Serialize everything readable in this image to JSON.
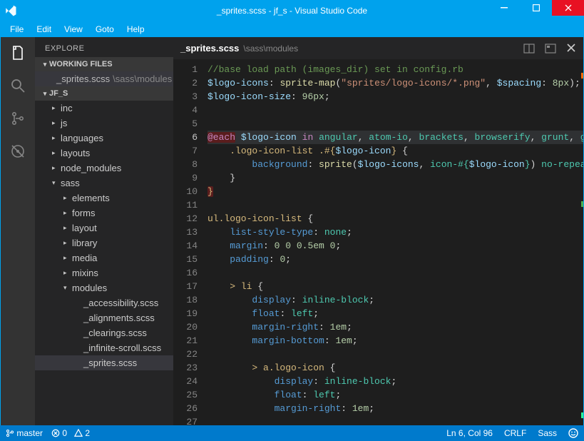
{
  "window": {
    "title": "_sprites.scss - jf_s - Visual Studio Code"
  },
  "menu": {
    "file": "File",
    "edit": "Edit",
    "view": "View",
    "goto": "Goto",
    "help": "Help"
  },
  "sidebar": {
    "header": "EXPLORE",
    "working_files_label": "WORKING FILES",
    "working_file": {
      "name": "_sprites.scss",
      "path": "\\sass\\modules"
    },
    "project_label": "JF_S",
    "tree": [
      {
        "label": "inc",
        "kind": "folder",
        "open": false,
        "depth": 1
      },
      {
        "label": "js",
        "kind": "folder",
        "open": false,
        "depth": 1
      },
      {
        "label": "languages",
        "kind": "folder",
        "open": false,
        "depth": 1
      },
      {
        "label": "layouts",
        "kind": "folder",
        "open": false,
        "depth": 1
      },
      {
        "label": "node_modules",
        "kind": "folder",
        "open": false,
        "depth": 1
      },
      {
        "label": "sass",
        "kind": "folder",
        "open": true,
        "depth": 1
      },
      {
        "label": "elements",
        "kind": "folder",
        "open": false,
        "depth": 2
      },
      {
        "label": "forms",
        "kind": "folder",
        "open": false,
        "depth": 2
      },
      {
        "label": "layout",
        "kind": "folder",
        "open": false,
        "depth": 2
      },
      {
        "label": "library",
        "kind": "folder",
        "open": false,
        "depth": 2
      },
      {
        "label": "media",
        "kind": "folder",
        "open": false,
        "depth": 2
      },
      {
        "label": "mixins",
        "kind": "folder",
        "open": false,
        "depth": 2
      },
      {
        "label": "modules",
        "kind": "folder",
        "open": true,
        "depth": 2
      },
      {
        "label": "_accessibility.scss",
        "kind": "file",
        "depth": 3
      },
      {
        "label": "_alignments.scss",
        "kind": "file",
        "depth": 3
      },
      {
        "label": "_clearings.scss",
        "kind": "file",
        "depth": 3
      },
      {
        "label": "_infinite-scroll.scss",
        "kind": "file",
        "depth": 3
      },
      {
        "label": "_sprites.scss",
        "kind": "file",
        "depth": 3,
        "selected": true
      }
    ]
  },
  "tab": {
    "name": "_sprites.scss",
    "path": "\\sass\\modules"
  },
  "status": {
    "branch": "master",
    "errors": "0",
    "warnings": "2",
    "cursor": "Ln 6, Col 96",
    "eol": "CRLF",
    "lang": "Sass"
  },
  "code": {
    "current_line": 6,
    "lines": [
      {
        "n": 1,
        "tokens": [
          [
            "c-comment",
            "//base load path (images_dir) set in config.rb"
          ]
        ]
      },
      {
        "n": 2,
        "tokens": [
          [
            "c-var",
            "$logo-icons"
          ],
          [
            "c-punc",
            ": "
          ],
          [
            "c-func",
            "sprite-map"
          ],
          [
            "c-punc",
            "("
          ],
          [
            "c-str",
            "\"sprites/logo-icons/*.png\""
          ],
          [
            "c-punc",
            ", "
          ],
          [
            "c-var",
            "$spacing"
          ],
          [
            "c-punc",
            ": "
          ],
          [
            "c-num",
            "8px"
          ],
          [
            "c-punc",
            ");"
          ]
        ]
      },
      {
        "n": 3,
        "tokens": [
          [
            "c-var",
            "$logo-icon-size"
          ],
          [
            "c-punc",
            ": "
          ],
          [
            "c-num",
            "96px"
          ],
          [
            "c-punc",
            ";"
          ]
        ]
      },
      {
        "n": 4,
        "tokens": []
      },
      {
        "n": 5,
        "tokens": []
      },
      {
        "n": 6,
        "current": true,
        "tokens": [
          [
            "c-key c-redbg",
            "@each"
          ],
          [
            "c-punc",
            " "
          ],
          [
            "c-var",
            "$logo-icon"
          ],
          [
            "c-punc",
            " "
          ],
          [
            "c-key",
            "in"
          ],
          [
            "c-punc",
            " "
          ],
          [
            "c-name",
            "angular"
          ],
          [
            "c-punc",
            ", "
          ],
          [
            "c-name",
            "atom-io"
          ],
          [
            "c-punc",
            ", "
          ],
          [
            "c-name",
            "brackets"
          ],
          [
            "c-punc",
            ", "
          ],
          [
            "c-name",
            "browserify"
          ],
          [
            "c-punc",
            ", "
          ],
          [
            "c-name",
            "grunt"
          ],
          [
            "c-punc",
            ", "
          ],
          [
            "c-name",
            "gu"
          ]
        ]
      },
      {
        "n": 7,
        "tokens": [
          [
            "c-punc",
            "    "
          ],
          [
            "c-sel",
            ".logo-icon-list .#{"
          ],
          [
            "c-var",
            "$logo-icon"
          ],
          [
            "c-sel",
            "}"
          ],
          [
            "c-punc",
            " {"
          ]
        ]
      },
      {
        "n": 8,
        "tokens": [
          [
            "c-punc",
            "        "
          ],
          [
            "c-blue",
            "background"
          ],
          [
            "c-punc",
            ": "
          ],
          [
            "c-func",
            "sprite"
          ],
          [
            "c-punc",
            "("
          ],
          [
            "c-var",
            "$logo-icons"
          ],
          [
            "c-punc",
            ", "
          ],
          [
            "c-name",
            "icon-#{"
          ],
          [
            "c-var",
            "$logo-icon"
          ],
          [
            "c-name",
            "}"
          ],
          [
            "c-punc",
            ") "
          ],
          [
            "c-name",
            "no-repeat"
          ]
        ]
      },
      {
        "n": 9,
        "tokens": [
          [
            "c-punc",
            "    }"
          ]
        ]
      },
      {
        "n": 10,
        "tokens": [
          [
            "c-sel c-redbg",
            "}"
          ]
        ]
      },
      {
        "n": 11,
        "tokens": []
      },
      {
        "n": 12,
        "tokens": [
          [
            "c-sel",
            "ul.logo-icon-list"
          ],
          [
            "c-punc",
            " {"
          ]
        ]
      },
      {
        "n": 13,
        "tokens": [
          [
            "c-punc",
            "    "
          ],
          [
            "c-blue",
            "list-style-type"
          ],
          [
            "c-punc",
            ": "
          ],
          [
            "c-name",
            "none"
          ],
          [
            "c-punc",
            ";"
          ]
        ]
      },
      {
        "n": 14,
        "tokens": [
          [
            "c-punc",
            "    "
          ],
          [
            "c-blue",
            "margin"
          ],
          [
            "c-punc",
            ": "
          ],
          [
            "c-num",
            "0 0 0.5em 0"
          ],
          [
            "c-punc",
            ";"
          ]
        ]
      },
      {
        "n": 15,
        "tokens": [
          [
            "c-punc",
            "    "
          ],
          [
            "c-blue",
            "padding"
          ],
          [
            "c-punc",
            ": "
          ],
          [
            "c-num",
            "0"
          ],
          [
            "c-punc",
            ";"
          ]
        ]
      },
      {
        "n": 16,
        "tokens": []
      },
      {
        "n": 17,
        "tokens": [
          [
            "c-punc",
            "    "
          ],
          [
            "c-sel",
            "> li"
          ],
          [
            "c-punc",
            " {"
          ]
        ]
      },
      {
        "n": 18,
        "tokens": [
          [
            "c-punc",
            "        "
          ],
          [
            "c-blue",
            "display"
          ],
          [
            "c-punc",
            ": "
          ],
          [
            "c-name",
            "inline-block"
          ],
          [
            "c-punc",
            ";"
          ]
        ]
      },
      {
        "n": 19,
        "tokens": [
          [
            "c-punc",
            "        "
          ],
          [
            "c-blue",
            "float"
          ],
          [
            "c-punc",
            ": "
          ],
          [
            "c-name",
            "left"
          ],
          [
            "c-punc",
            ";"
          ]
        ]
      },
      {
        "n": 20,
        "tokens": [
          [
            "c-punc",
            "        "
          ],
          [
            "c-blue",
            "margin-right"
          ],
          [
            "c-punc",
            ": "
          ],
          [
            "c-num",
            "1em"
          ],
          [
            "c-punc",
            ";"
          ]
        ]
      },
      {
        "n": 21,
        "tokens": [
          [
            "c-punc",
            "        "
          ],
          [
            "c-blue",
            "margin-bottom"
          ],
          [
            "c-punc",
            ": "
          ],
          [
            "c-num",
            "1em"
          ],
          [
            "c-punc",
            ";"
          ]
        ]
      },
      {
        "n": 22,
        "tokens": []
      },
      {
        "n": 23,
        "tokens": [
          [
            "c-punc",
            "        "
          ],
          [
            "c-sel",
            "> a.logo-icon"
          ],
          [
            "c-punc",
            " {"
          ]
        ]
      },
      {
        "n": 24,
        "tokens": [
          [
            "c-punc",
            "            "
          ],
          [
            "c-blue",
            "display"
          ],
          [
            "c-punc",
            ": "
          ],
          [
            "c-name",
            "inline-block"
          ],
          [
            "c-punc",
            ";"
          ]
        ]
      },
      {
        "n": 25,
        "tokens": [
          [
            "c-punc",
            "            "
          ],
          [
            "c-blue",
            "float"
          ],
          [
            "c-punc",
            ": "
          ],
          [
            "c-name",
            "left"
          ],
          [
            "c-punc",
            ";"
          ]
        ]
      },
      {
        "n": 26,
        "tokens": [
          [
            "c-punc",
            "            "
          ],
          [
            "c-blue",
            "margin-right"
          ],
          [
            "c-punc",
            ": "
          ],
          [
            "c-num",
            "1em"
          ],
          [
            "c-punc",
            ";"
          ]
        ]
      },
      {
        "n": 27,
        "tokens": []
      }
    ]
  }
}
